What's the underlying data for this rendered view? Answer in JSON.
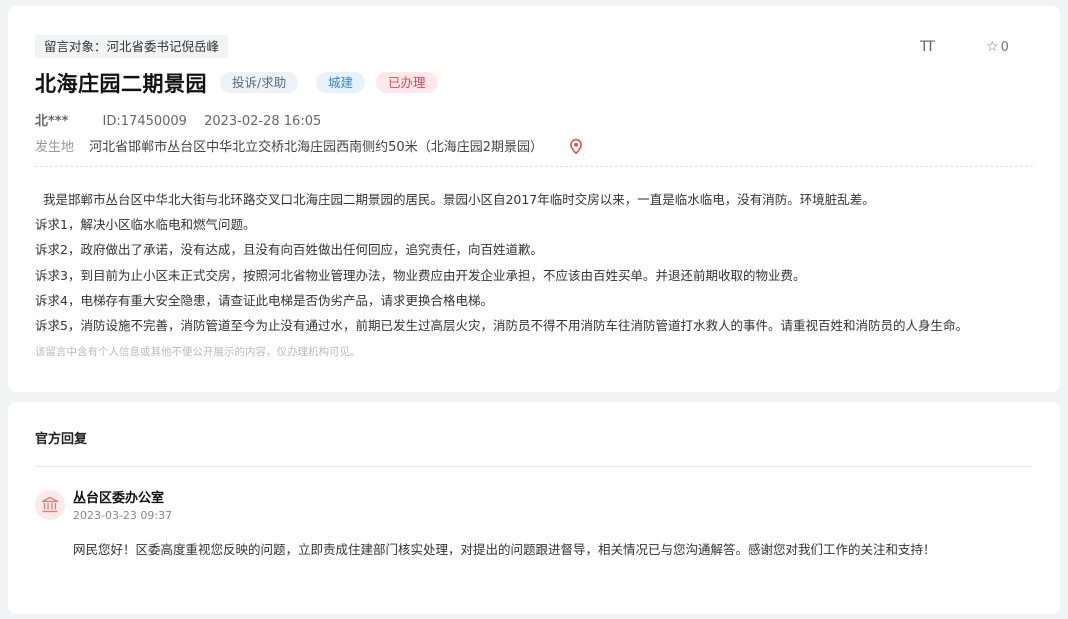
{
  "message": {
    "recipient": "留言对象：河北省委书记倪岳峰",
    "font_size_label": "TT",
    "favorite_count": "0",
    "title": "北海庄园二期景园",
    "tags": {
      "type": "投诉/求助",
      "category": "城建",
      "status": "已办理"
    },
    "author": "北***",
    "id": "ID:17450009",
    "datetime": "2023-02-28 16:05",
    "location_label": "发生地",
    "location": "河北省邯郸市丛台区中华北立交桥北海庄园西南侧约50米（北海庄园2期景园）",
    "body": [
      "  我是邯郸市丛台区中华北大街与北环路交叉口北海庄园二期景园的居民。景园小区自2017年临时交房以来，一直是临水临电，没有消防。环境脏乱差。",
      "诉求1，解决小区临水临电和燃气问题。",
      "诉求2，政府做出了承诺，没有达成，且没有向百姓做出任何回应，追究责任，向百姓道歉。",
      "诉求3，到目前为止小区未正式交房，按照河北省物业管理办法，物业费应由开发企业承担，不应该由百姓买单。并退还前期收取的物业费。",
      "诉求4，电梯存有重大安全隐患，请查证此电梯是否伪劣产品，请求更换合格电梯。",
      "诉求5，消防设施不完善，消防管道至今为止没有通过水，前期已发生过高层火灾，消防员不得不用消防车往消防管道打水救人的事件。请重视百姓和消防员的人身生命。"
    ],
    "privacy_note": "该留言中含有个人信息或其他不便公开展示的内容，仅办理机构可见。"
  },
  "reply": {
    "heading": "官方回复",
    "org": "丛台区委办公室",
    "date": "2023-03-23 09:37",
    "text": "网民您好！区委高度重视您反映的问题，立即责成住建部门核实处理，对提出的问题跟进督导，相关情况已与您沟通解答。感谢您对我们工作的关注和支持！"
  },
  "colors": {
    "status_red": "#e0475a",
    "category_blue": "#3a86c8",
    "pin_red": "#e8473e",
    "page_bg": "#f2f3f5"
  },
  "icons": {
    "favorite": "star-outline-icon",
    "location": "map-pin-icon",
    "org": "government-building-icon"
  }
}
